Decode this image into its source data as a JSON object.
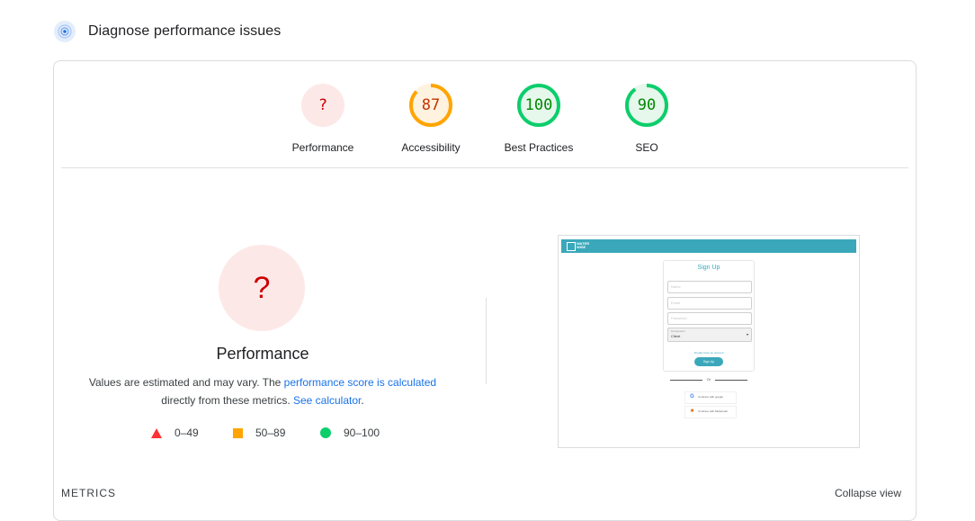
{
  "header": {
    "title": "Diagnose performance issues",
    "icon": "lighthouse-icon"
  },
  "categories": [
    {
      "label": "Performance",
      "value": "?",
      "status": "error",
      "score": null,
      "ring_color": "#fde8e8",
      "text_color": "#cc0000"
    },
    {
      "label": "Accessibility",
      "value": "87",
      "status": "average",
      "score": 87,
      "ring_color": "#ffa400",
      "fill_color": "#fff3e0",
      "text_color": "#c33300"
    },
    {
      "label": "Best Practices",
      "value": "100",
      "status": "pass",
      "score": 100,
      "ring_color": "#0cce6b",
      "fill_color": "#e6f7ec",
      "text_color": "#008800"
    },
    {
      "label": "SEO",
      "value": "90",
      "status": "pass",
      "score": 90,
      "ring_color": "#0cce6b",
      "fill_color": "#e6f7ec",
      "text_color": "#008800"
    }
  ],
  "performance": {
    "value": "?",
    "title": "Performance",
    "desc_prefix": "Values are estimated and may vary. The ",
    "desc_link1": "performance score is calculated",
    "desc_mid": "directly from these metrics. ",
    "desc_link2": "See calculator",
    "desc_suffix": "."
  },
  "legend": [
    {
      "range": "0–49",
      "shape": "triangle",
      "color": "#ff3333"
    },
    {
      "range": "50–89",
      "shape": "square",
      "color": "#ffa400"
    },
    {
      "range": "90–100",
      "shape": "circle",
      "color": "#0cce6b"
    }
  ],
  "screenshot": {
    "brand": "WATER\nWISE",
    "form_title": "Sign Up",
    "fields": [
      "Name",
      "Email",
      "Password"
    ],
    "select_caption": "Designation",
    "select_value": "Client",
    "link": "Already have an account",
    "button": "Sign Up",
    "or": "Or",
    "sso": [
      {
        "icon": "google-icon",
        "label": "Continue with google"
      },
      {
        "icon": "metamask-icon",
        "label": "Continue with Metamask"
      }
    ]
  },
  "footer": {
    "metrics": "METRICS",
    "collapse": "Collapse view"
  }
}
